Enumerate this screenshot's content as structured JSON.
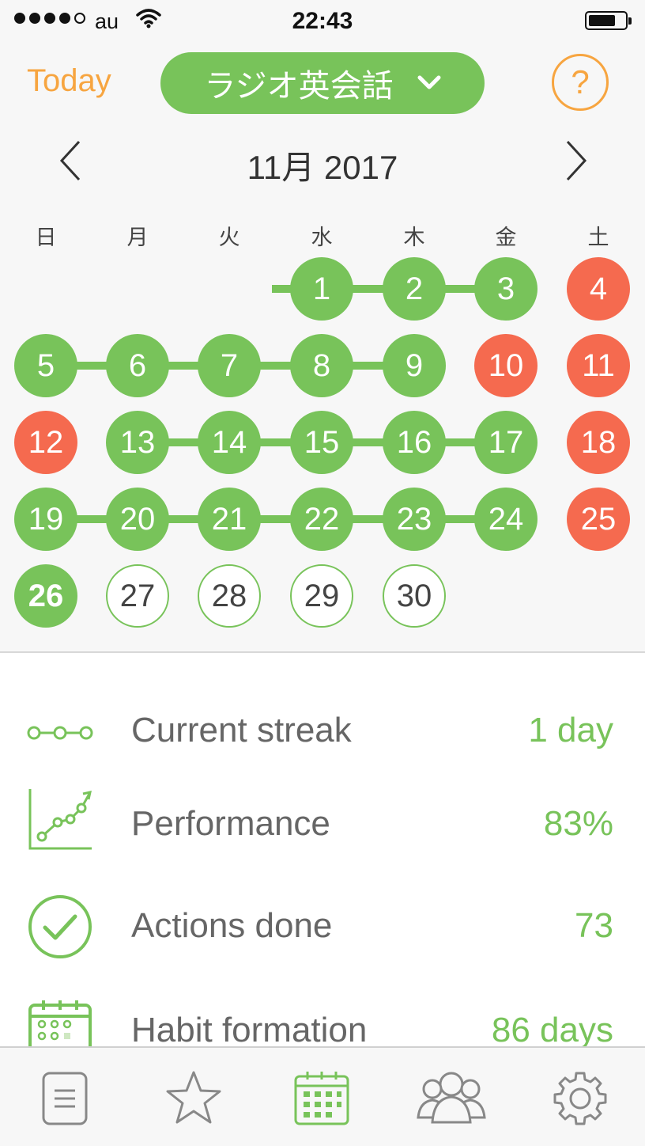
{
  "status_bar": {
    "carrier": "au",
    "time": "22:43"
  },
  "header": {
    "today_label": "Today",
    "habit_name": "ラジオ英会話",
    "help_symbol": "?"
  },
  "calendar": {
    "month_title": "11月 2017",
    "weekdays": [
      "日",
      "月",
      "火",
      "水",
      "木",
      "金",
      "土"
    ],
    "days": [
      {
        "label": "1",
        "status": "done"
      },
      {
        "label": "2",
        "status": "done"
      },
      {
        "label": "3",
        "status": "done"
      },
      {
        "label": "4",
        "status": "missed"
      },
      {
        "label": "5",
        "status": "done"
      },
      {
        "label": "6",
        "status": "done"
      },
      {
        "label": "7",
        "status": "done"
      },
      {
        "label": "8",
        "status": "done"
      },
      {
        "label": "9",
        "status": "done"
      },
      {
        "label": "10",
        "status": "missed"
      },
      {
        "label": "11",
        "status": "missed"
      },
      {
        "label": "12",
        "status": "missed"
      },
      {
        "label": "13",
        "status": "done"
      },
      {
        "label": "14",
        "status": "done"
      },
      {
        "label": "15",
        "status": "done"
      },
      {
        "label": "16",
        "status": "done"
      },
      {
        "label": "17",
        "status": "done"
      },
      {
        "label": "18",
        "status": "missed"
      },
      {
        "label": "19",
        "status": "done"
      },
      {
        "label": "20",
        "status": "done"
      },
      {
        "label": "21",
        "status": "done"
      },
      {
        "label": "22",
        "status": "done"
      },
      {
        "label": "23",
        "status": "done"
      },
      {
        "label": "24",
        "status": "done"
      },
      {
        "label": "25",
        "status": "missed"
      },
      {
        "label": "26",
        "status": "today"
      },
      {
        "label": "27",
        "status": "future"
      },
      {
        "label": "28",
        "status": "future"
      },
      {
        "label": "29",
        "status": "future"
      },
      {
        "label": "30",
        "status": "future"
      }
    ]
  },
  "stats": [
    {
      "icon": "streak-icon",
      "label": "Current streak",
      "value": "1 day"
    },
    {
      "icon": "performance-chart-icon",
      "label": "Performance",
      "value": "83%"
    },
    {
      "icon": "checkmark-circle-icon",
      "label": "Actions done",
      "value": "73"
    },
    {
      "icon": "habit-calendar-icon",
      "label": "Habit formation",
      "value": "86 days"
    }
  ],
  "tab_bar": {
    "items": [
      {
        "icon": "list-icon",
        "active": false
      },
      {
        "icon": "star-icon",
        "active": false
      },
      {
        "icon": "calendar-icon",
        "active": true
      },
      {
        "icon": "people-icon",
        "active": false
      },
      {
        "icon": "gear-icon",
        "active": false
      }
    ]
  },
  "colors": {
    "accent_green": "#78c35a",
    "missed_red": "#f56a4f",
    "today_orange": "#f7a540"
  }
}
